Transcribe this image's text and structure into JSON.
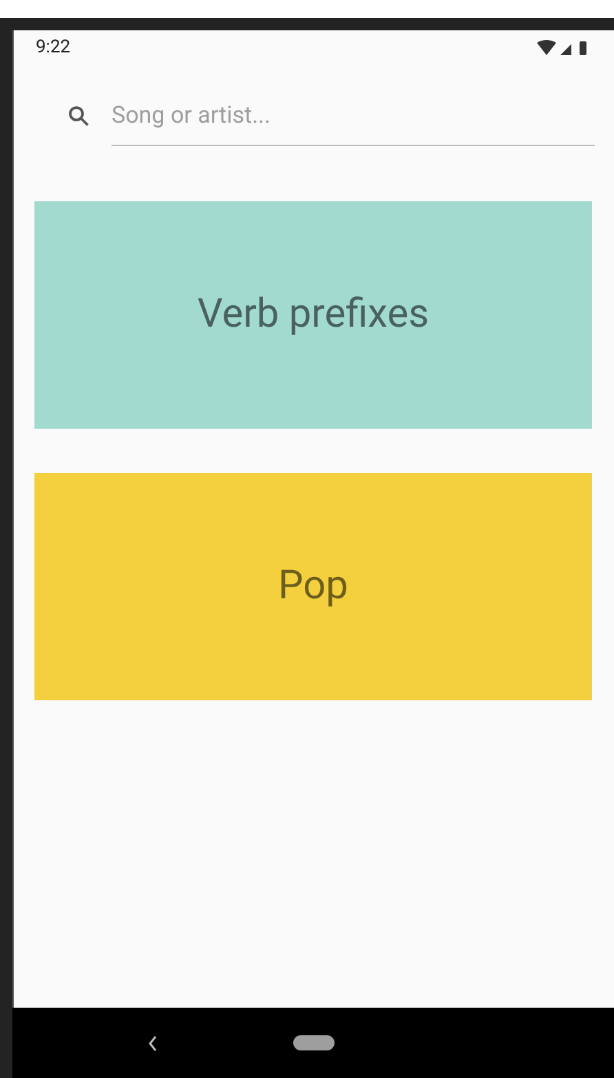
{
  "status_bar": {
    "time": "9:22"
  },
  "search": {
    "placeholder": "Song or artist..."
  },
  "cards": [
    {
      "label": "Verb prefixes",
      "color": "#a3dad0"
    },
    {
      "label": "Pop",
      "color": "#f4d03f"
    }
  ]
}
